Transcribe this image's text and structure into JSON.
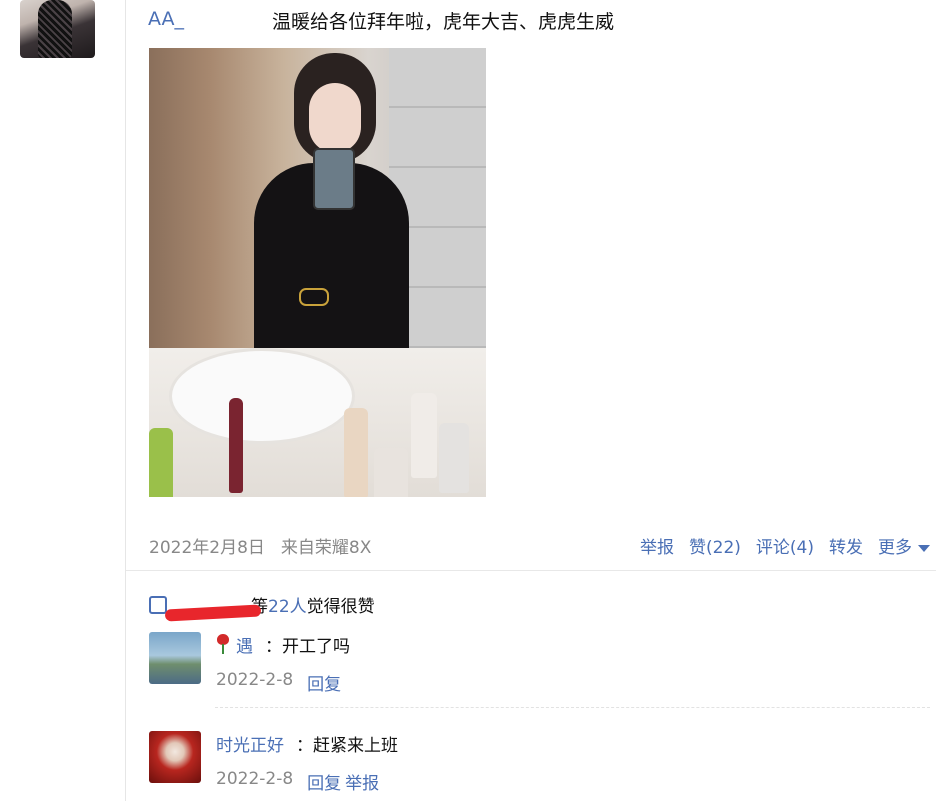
{
  "post": {
    "author": "AA_",
    "text": "温暖给各位拜年啦，虎年大吉、虎虎生威",
    "date": "2022年2月8日",
    "source": "来自荣耀8X",
    "actions": {
      "report": "举报",
      "like": "赞(22)",
      "comment": "评论(4)",
      "forward": "转发",
      "more": "更多"
    }
  },
  "likes": {
    "liker_suffix": "等",
    "count": "22人",
    "suffix": "觉得很赞"
  },
  "comments": [
    {
      "name": "遇",
      "text": "：开工了吗",
      "date": "2022-2-8",
      "reply": "回复",
      "report": ""
    },
    {
      "name": "时光正好",
      "text": "：赶紧来上班",
      "date": "2022-2-8",
      "reply": "回复",
      "report": "举报"
    }
  ],
  "colors": {
    "link": "#4a6fb5",
    "meta": "#888888",
    "scribble": "#e8262c"
  },
  "icons": [
    "rose-icon",
    "thumb-up-icon",
    "dropdown-triangle-icon"
  ]
}
